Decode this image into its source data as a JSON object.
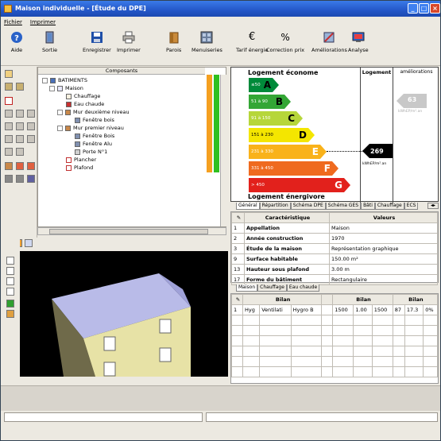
{
  "window": {
    "title": "Maison individuelle - [Étude du DPE]"
  },
  "menu": {
    "file": "Fichier",
    "print": "Imprimer"
  },
  "toolbar": {
    "aide": "Aide",
    "sortie": "Sortie",
    "enregistrer": "Enregistrer",
    "imprimer": "Imprimer",
    "parois": "Parois",
    "menuiseries": "Menuiseries",
    "tarif_energie": "Tarif énergie",
    "correction_prix": "Correction prix",
    "ameliorations": "Améliorations",
    "analyse": "Analyse"
  },
  "tree": {
    "header": "Composants",
    "items": [
      "BATIMENTS",
      "Maison",
      "Chauffage",
      "Eau chaude",
      "Mur deuxième niveau",
      "Fenêtre bois",
      "Mur premier niveau",
      "Fenêtre Bois",
      "Fenêtre Alu",
      "Porte N°1",
      "Plancher",
      "Plafond"
    ]
  },
  "dpe": {
    "title_top": "Logement économe",
    "title_bottom": "Logement énergivore",
    "col_logement": "Logement",
    "col_ameliorations": "améliorations",
    "bands": [
      {
        "range": "≤50",
        "letter": "A",
        "color": "#008a3a"
      },
      {
        "range": "51 à 90",
        "letter": "B",
        "color": "#33a635"
      },
      {
        "range": "91 à 150",
        "letter": "C",
        "color": "#b6d63a"
      },
      {
        "range": "151 à 230",
        "letter": "D",
        "color": "#f4e600"
      },
      {
        "range": "231 à 330",
        "letter": "E",
        "color": "#f9b21a"
      },
      {
        "range": "331 à 450",
        "letter": "F",
        "color": "#ef6a1f"
      },
      {
        "range": "> 450",
        "letter": "G",
        "color": "#e2211c"
      }
    ],
    "logement_value": "269",
    "logement_unit": "kWhEP/m².an",
    "amelioration_value": "63",
    "amelioration_unit": "kWhEP/m².an"
  },
  "dpe_tabs": [
    "Général",
    "Répartition",
    "Schéma DPE",
    "Schéma GES",
    "Bâti",
    "Chauffage",
    "ECS"
  ],
  "props": {
    "col_char": "Caractéristique",
    "col_val": "Valeurs",
    "rows": [
      {
        "n": "1",
        "label": "Appellation",
        "value": "Maison"
      },
      {
        "n": "2",
        "label": "Année construction",
        "value": "1970"
      },
      {
        "n": "3",
        "label": "Étude de la maison",
        "value": "Représentation graphique"
      },
      {
        "n": "9",
        "label": "Surface habitable",
        "value": "150.00 m²"
      },
      {
        "n": "13",
        "label": "Hauteur sous plafond",
        "value": "3.00 m"
      },
      {
        "n": "17",
        "label": "Forme du bâtiment",
        "value": "Rectangulaire"
      }
    ]
  },
  "lower_tabs": [
    "Maison",
    "Chauffage",
    "Eau chaude"
  ],
  "bilan": {
    "header1": "Bilan",
    "header2": "Bilan",
    "header3": "Bilan",
    "row": [
      "1",
      "Hyg",
      "Ventilati",
      "Hygro B",
      "",
      "1500",
      "1.00",
      "1500",
      "87",
      "17.3",
      "0%"
    ]
  }
}
